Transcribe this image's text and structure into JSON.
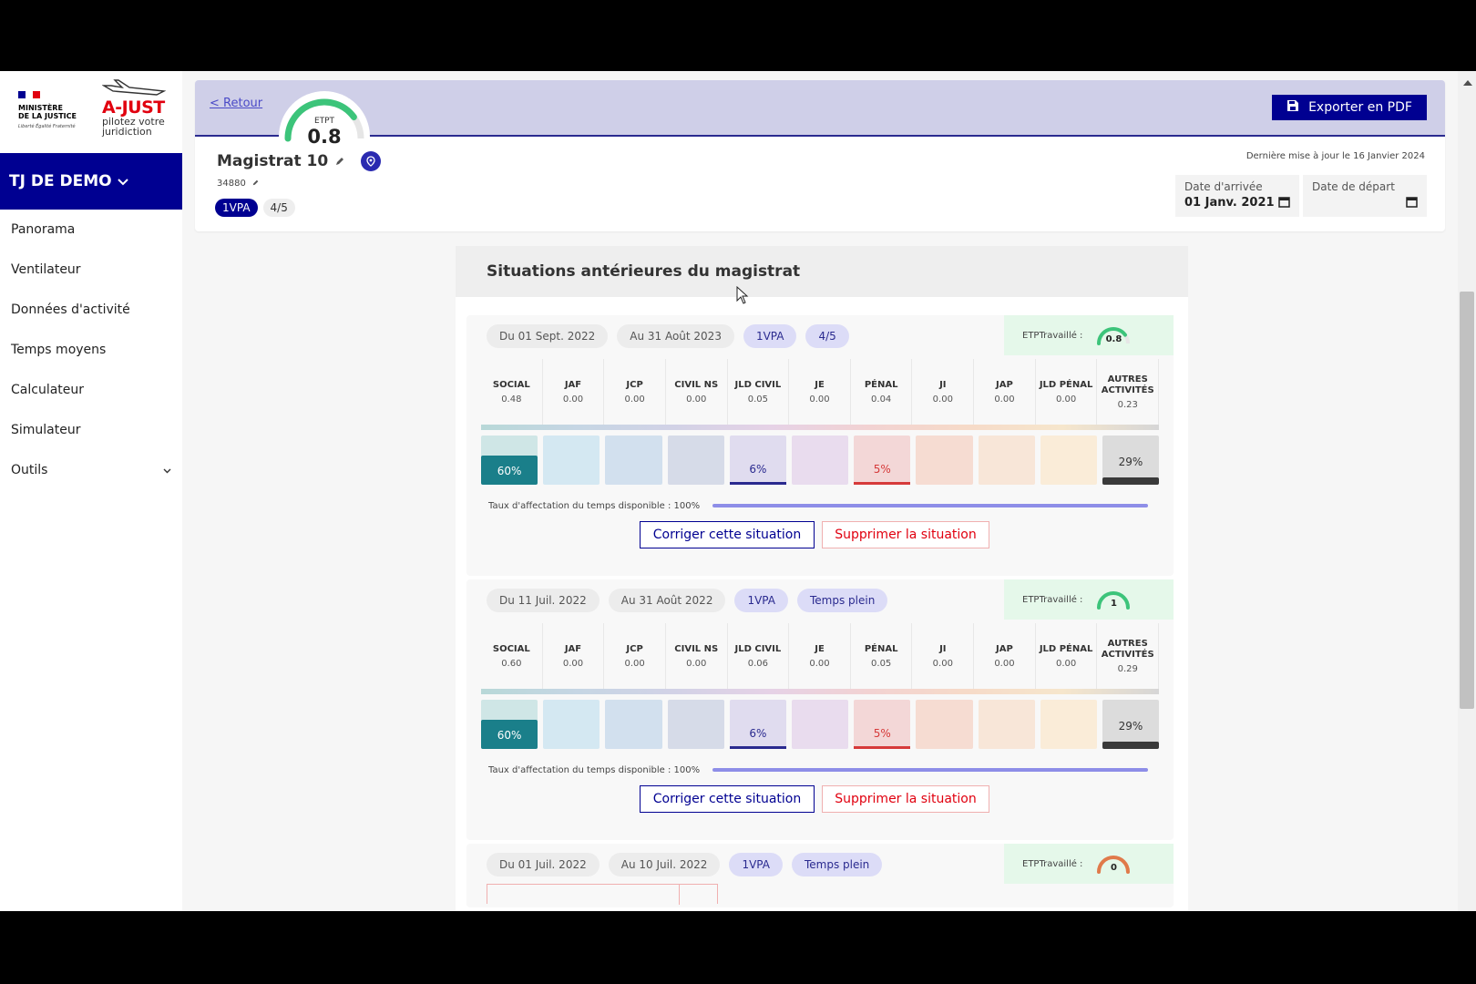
{
  "sidebar": {
    "ministry": [
      "MINISTÈRE",
      "DE LA JUSTICE"
    ],
    "motto": "Liberté Égalité Fraternité",
    "brand_name": "A-JUST",
    "brand_tagline": "pilotez votre juridiction",
    "court": "TJ DE DEMO",
    "nav": [
      {
        "label": "Panorama"
      },
      {
        "label": "Ventilateur"
      },
      {
        "label": "Données d'activité"
      },
      {
        "label": "Temps moyens"
      },
      {
        "label": "Calculateur"
      },
      {
        "label": "Simulateur"
      },
      {
        "label": "Outils"
      }
    ]
  },
  "header": {
    "back": "< Retour",
    "export": "Exporter en PDF",
    "etpt_label": "ETPT",
    "etpt_value": "0.8",
    "etpt_fraction": 0.8,
    "name": "Magistrat 10",
    "id": "34880",
    "tags": [
      "1VPA",
      "4/5"
    ],
    "last_update": "Dernière mise à jour le 16 Janvier 2024",
    "arrival_label": "Date d'arrivée",
    "arrival_value": "01 Janv. 2021",
    "departure_label": "Date de départ",
    "departure_value": ""
  },
  "panel": {
    "title": "Situations antérieures du magistrat",
    "columns": [
      "SOCIAL",
      "JAF",
      "JCP",
      "CIVIL NS",
      "JLD CIVIL",
      "JE",
      "PÉNAL",
      "JI",
      "JAP",
      "JLD PÉNAL",
      "AUTRES ACTIVITÉS"
    ],
    "column_colors": [
      "#cfe6e6",
      "#d4e8f2",
      "#d2e0ee",
      "#d6dbe8",
      "#e0dcef",
      "#e9dcee",
      "#f3d7d7",
      "#f6dcd2",
      "#f8e6d8",
      "#faecd8",
      "#dcdcdc"
    ],
    "fill_colors": {
      "SOCIAL": "#1a7f8a",
      "JLD CIVIL": "#2a2a8f",
      "PÉNAL": "#d63a3a",
      "AUTRES ACTIVITÉS": "#3a3a3a"
    },
    "etp_label": "ETPTravaillé :",
    "taux_label": "Taux d'affectation du temps disponible : 100%",
    "fix_label": "Corriger cette situation",
    "delete_label": "Supprimer la situation",
    "situations": [
      {
        "from": "Du 01 Sept. 2022",
        "to": "Au 31 Août 2023",
        "fn": "1VPA",
        "time": "4/5",
        "etp": "0.8",
        "etp_fraction": 0.8,
        "values": [
          "0.48",
          "0.00",
          "0.00",
          "0.00",
          "0.05",
          "0.00",
          "0.04",
          "0.00",
          "0.00",
          "0.00",
          "0.23"
        ],
        "percents": {
          "SOCIAL": "60%",
          "JLD CIVIL": "6%",
          "PÉNAL": "5%",
          "AUTRES ACTIVITÉS": "29%"
        },
        "fractions": {
          "SOCIAL": 0.6,
          "JLD CIVIL": 0.06,
          "PÉNAL": 0.05,
          "AUTRES ACTIVITÉS": 0.29
        }
      },
      {
        "from": "Du 11 Juil. 2022",
        "to": "Au 31 Août 2022",
        "fn": "1VPA",
        "time": "Temps plein",
        "etp": "1",
        "etp_fraction": 1,
        "values": [
          "0.60",
          "0.00",
          "0.00",
          "0.00",
          "0.06",
          "0.00",
          "0.05",
          "0.00",
          "0.00",
          "0.00",
          "0.29"
        ],
        "percents": {
          "SOCIAL": "60%",
          "JLD CIVIL": "6%",
          "PÉNAL": "5%",
          "AUTRES ACTIVITÉS": "29%"
        },
        "fractions": {
          "SOCIAL": 0.6,
          "JLD CIVIL": 0.06,
          "PÉNAL": 0.05,
          "AUTRES ACTIVITÉS": 0.29
        }
      },
      {
        "from": "Du 01 Juil. 2022",
        "to": "Au 10 Juil. 2022",
        "fn": "1VPA",
        "time": "Temps plein",
        "etp": "0",
        "etp_fraction": 0
      }
    ]
  }
}
